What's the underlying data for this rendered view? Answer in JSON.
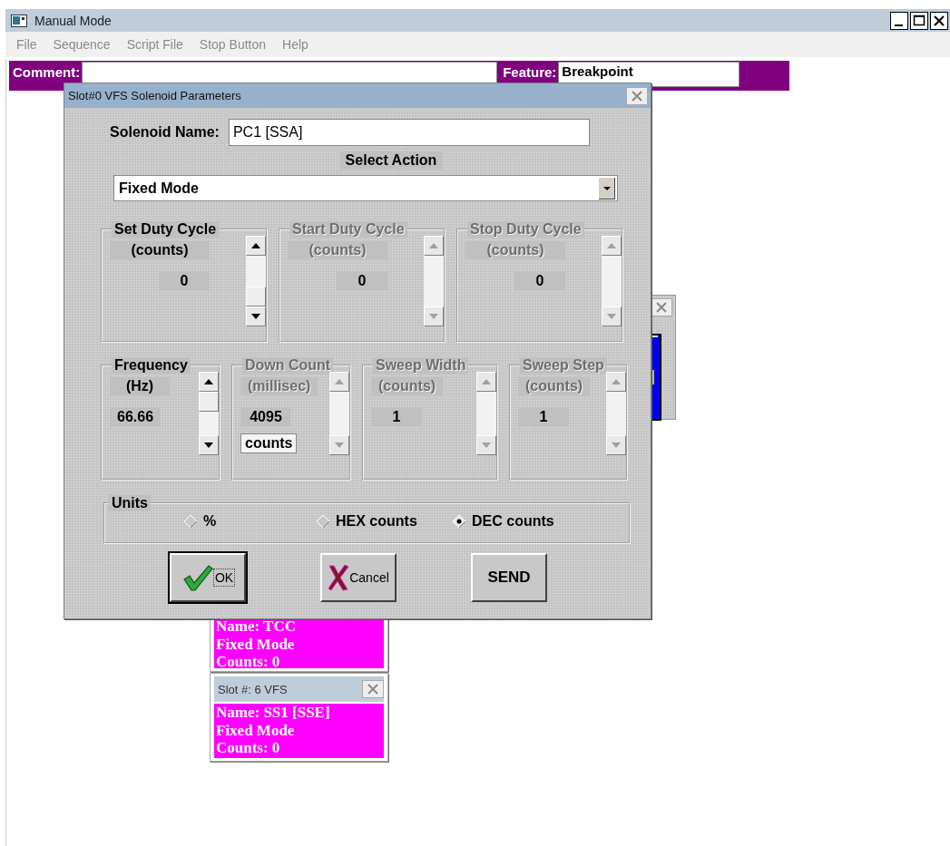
{
  "window": {
    "title": "Manual Mode"
  },
  "menu": [
    "File",
    "Sequence",
    "Script File",
    "Stop Button",
    "Help"
  ],
  "comment": {
    "label": "Comment:"
  },
  "feature": {
    "label": "Feature:",
    "value": "Breakpoint"
  },
  "dialog": {
    "title": "Slot#0 VFS Solenoid Parameters",
    "solenoid_name": {
      "label": "Solenoid Name:",
      "value": "PC1 [SSA]"
    },
    "select_action": {
      "label": "Select Action",
      "value": "Fixed Mode"
    },
    "duty_groups": [
      {
        "title": "Set Duty Cycle",
        "unit": "(counts)",
        "value": "0",
        "disabled": false
      },
      {
        "title": "Start Duty Cycle",
        "unit": "(counts)",
        "value": "0",
        "disabled": true
      },
      {
        "title": "Stop Duty Cycle",
        "unit": "(counts)",
        "value": "0",
        "disabled": true
      }
    ],
    "timing_groups": [
      {
        "title": "Frequency",
        "unit": "(Hz)",
        "value": "66.66",
        "disabled": false
      },
      {
        "title": "Down Count",
        "unit": "(millisec)",
        "value": "4095",
        "disabled": true,
        "button": "counts"
      },
      {
        "title": "Sweep Width",
        "unit": "(counts)",
        "value": "1",
        "disabled": true
      },
      {
        "title": "Sweep Step",
        "unit": "(counts)",
        "value": "1",
        "disabled": true
      }
    ],
    "units": {
      "title": "Units",
      "options": [
        {
          "label": "%",
          "selected": false,
          "disabled": true
        },
        {
          "label": "HEX counts",
          "selected": false,
          "disabled": true
        },
        {
          "label": "DEC counts",
          "selected": true,
          "disabled": false
        }
      ]
    },
    "buttons": [
      {
        "kind": "ok",
        "label": "OK",
        "default": true
      },
      {
        "kind": "cancel",
        "label": "Cancel",
        "default": false
      },
      {
        "kind": "send",
        "label": "SEND",
        "default": false
      }
    ]
  },
  "slot_windows": [
    {
      "lines": [
        "Name: TCC",
        "Fixed Mode",
        "Counts: 0"
      ]
    },
    {
      "title": "Slot #: 6 VFS",
      "lines": [
        "Name: SS1 [SSE]",
        "Fixed Mode",
        "Counts: 0"
      ]
    }
  ]
}
